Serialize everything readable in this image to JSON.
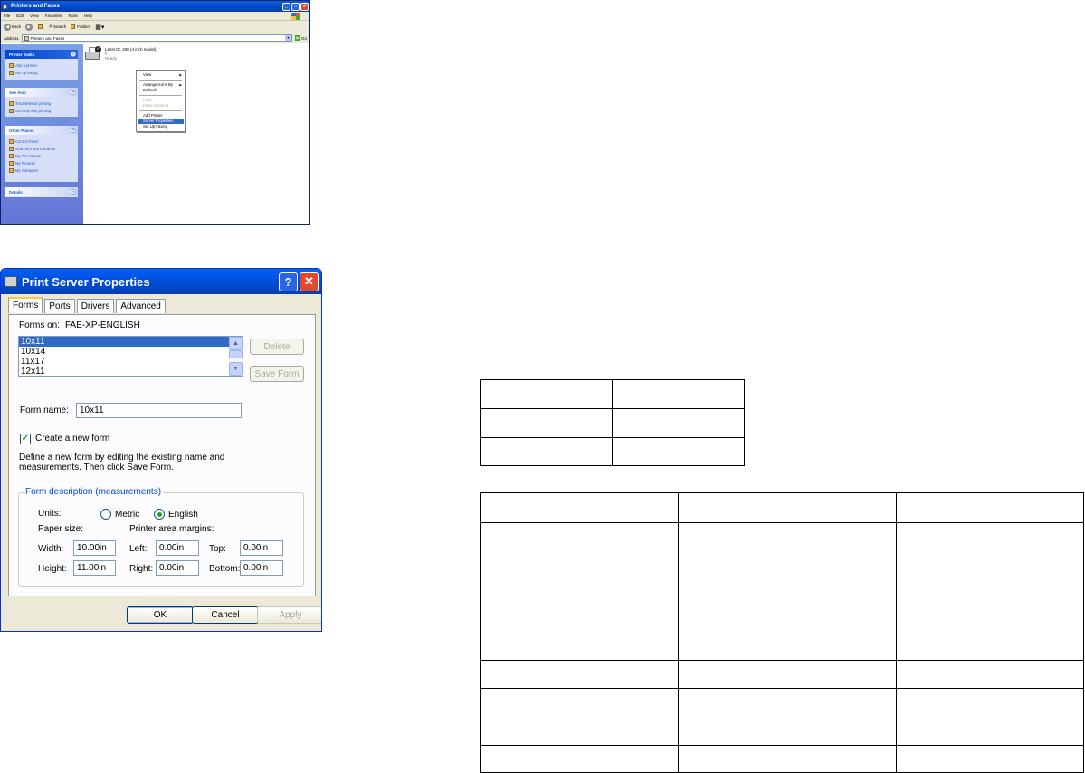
{
  "explorer": {
    "title": "Printers and Faxes",
    "menu": [
      "File",
      "Edit",
      "View",
      "Favorites",
      "Tools",
      "Help"
    ],
    "toolbar": {
      "back": "Back",
      "search": "Search",
      "folders": "Folders"
    },
    "address_label": "Address",
    "address_value": "Printers and Faxes",
    "go_label": "Go",
    "panes": {
      "printer_tasks": {
        "title": "Printer Tasks",
        "items": [
          "Add a printer",
          "Set up faxing"
        ]
      },
      "see_also": {
        "title": "See Also",
        "items": [
          "Troubleshoot printing",
          "Get help with printing"
        ]
      },
      "other_places": {
        "title": "Other Places",
        "items": [
          "Control Panel",
          "Scanners and Cameras",
          "My Documents",
          "My Pictures",
          "My Computer"
        ]
      },
      "details": {
        "title": "Details"
      }
    },
    "printer": {
      "name": "Label Dr. 200 (4 inch model)",
      "jobs": "0",
      "status": "Ready"
    },
    "context_menu": {
      "view": "View",
      "arrange": "Arrange Icons By",
      "refresh": "Refresh",
      "paste": "Paste",
      "paste_shortcut": "Paste Shortcut",
      "add_printer": "Add Printer",
      "server_properties": "Server Properties",
      "set_up_faxing": "Set Up Faxing"
    }
  },
  "dialog": {
    "title": "Print Server Properties",
    "tabs": [
      "Forms",
      "Ports",
      "Drivers",
      "Advanced"
    ],
    "forms_on_label": "Forms on:",
    "forms_on_value": "FAE-XP-ENGLISH",
    "forms_list": [
      "10x11",
      "10x14",
      "11x17",
      "12x11"
    ],
    "delete_label": "Delete",
    "save_form_label": "Save Form",
    "form_name_label": "Form name:",
    "form_name_value": "10x11",
    "create_new_form_label": "Create a new form",
    "create_new_form_checked": true,
    "define_text_1": "Define a new form by editing the existing name and",
    "define_text_2": "measurements.  Then click Save Form.",
    "group_label": "Form description (measurements)",
    "units_label": "Units:",
    "metric_label": "Metric",
    "english_label": "English",
    "units_selected": "English",
    "paper_size_label": "Paper size:",
    "margins_label": "Printer area margins:",
    "width_label": "Width:",
    "width_value": "10.00in",
    "height_label": "Height:",
    "height_value": "11.00in",
    "left_label": "Left:",
    "left_value": "0.00in",
    "right_label": "Right:",
    "right_value": "0.00in",
    "top_label": "Top:",
    "top_value": "0.00in",
    "bottom_label": "Bottom:",
    "bottom_value": "0.00in",
    "ok_label": "OK",
    "cancel_label": "Cancel",
    "apply_label": "Apply"
  }
}
